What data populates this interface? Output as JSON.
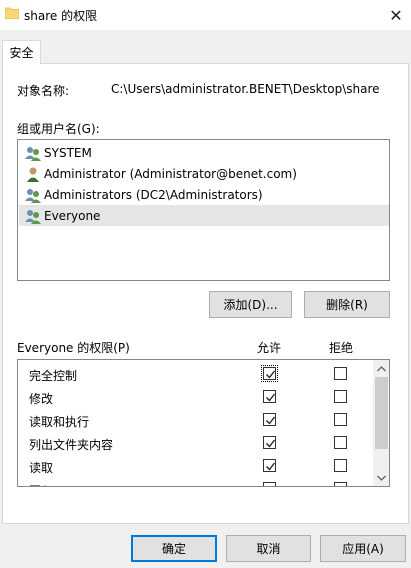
{
  "window": {
    "title": "share 的权限",
    "close_glyph": "✕"
  },
  "tabs": [
    {
      "label": "安全"
    }
  ],
  "object": {
    "label": "对象名称:",
    "value": "C:\\Users\\administrator.BENET\\Desktop\\share"
  },
  "users": {
    "label": "组或用户名(G):",
    "items": [
      {
        "name": "SYSTEM",
        "icon": "group-icon",
        "selected": false
      },
      {
        "name": "Administrator (Administrator@benet.com)",
        "icon": "user-icon",
        "selected": false
      },
      {
        "name": "Administrators (DC2\\Administrators)",
        "icon": "group-icon",
        "selected": false
      },
      {
        "name": "Everyone",
        "icon": "group-icon",
        "selected": true
      }
    ],
    "add_label": "添加(D)...",
    "remove_label": "删除(R)"
  },
  "permissions": {
    "label": "Everyone 的权限(P)",
    "allow_header": "允许",
    "deny_header": "拒绝",
    "rows": [
      {
        "name": "完全控制",
        "allow": true,
        "deny": false
      },
      {
        "name": "修改",
        "allow": true,
        "deny": false
      },
      {
        "name": "读取和执行",
        "allow": true,
        "deny": false
      },
      {
        "name": "列出文件夹内容",
        "allow": true,
        "deny": false
      },
      {
        "name": "读取",
        "allow": true,
        "deny": false
      },
      {
        "name": "写入",
        "allow": true,
        "deny": false
      }
    ]
  },
  "footer": {
    "ok_label": "确定",
    "cancel_label": "取消",
    "apply_label": "应用(A)"
  },
  "colors": {
    "accent": "#0078d7",
    "folder": "#f8d775",
    "selection": "#e5e5e5"
  }
}
